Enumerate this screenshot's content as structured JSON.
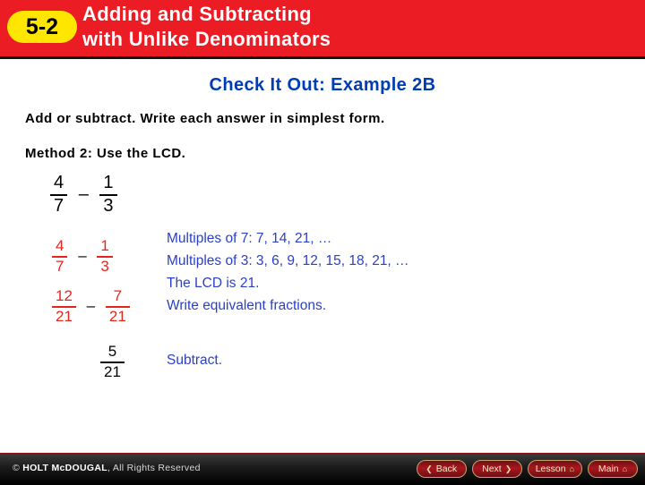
{
  "header": {
    "lesson_number": "5-2",
    "title_line1": "Adding and Subtracting",
    "title_line2": "with Unlike Denominators",
    "bg_color": "#ec1c24",
    "badge_color": "#ffe600"
  },
  "slide": {
    "example_title": "Check It Out: Example 2B",
    "instruction": "Add or subtract. Write each answer in simplest form.",
    "method": "Method 2: Use the LCD."
  },
  "problem": {
    "first_numerator": "4",
    "first_denominator": "7",
    "operator": "–",
    "second_numerator": "1",
    "second_denominator": "3"
  },
  "work": {
    "row1": {
      "color": "#e8251c",
      "first_numerator": "4",
      "first_denominator": "7",
      "operator": "–",
      "second_numerator": "1",
      "second_denominator": "3"
    },
    "row2": {
      "color": "#e8251c",
      "first_numerator": "12",
      "first_denominator": "21",
      "operator": "–",
      "second_numerator": "7",
      "second_denominator": "21"
    },
    "answer": {
      "numerator": "5",
      "denominator": "21"
    }
  },
  "notes": {
    "color": "#2b40c8",
    "line1": "Multiples of 7: 7, 14, 21, …",
    "line2": "Multiples of 3: 3, 6, 9, 12, 15, 18, 21, …",
    "line3": "The LCD is 21.",
    "line4": "Write equivalent fractions.",
    "line5": "Subtract."
  },
  "footer": {
    "copyright_symbol": "©",
    "brand": "HOLT McDOUGAL",
    "rights": ", All Rights Reserved",
    "buttons": [
      {
        "label": "Back",
        "glyph": "❮",
        "glyph_side": "left"
      },
      {
        "label": "Next",
        "glyph": "❯",
        "glyph_side": "right"
      },
      {
        "label": "Lesson",
        "glyph": "⌂",
        "glyph_side": "right"
      },
      {
        "label": "Main",
        "glyph": "⌂",
        "glyph_side": "right"
      }
    ]
  }
}
